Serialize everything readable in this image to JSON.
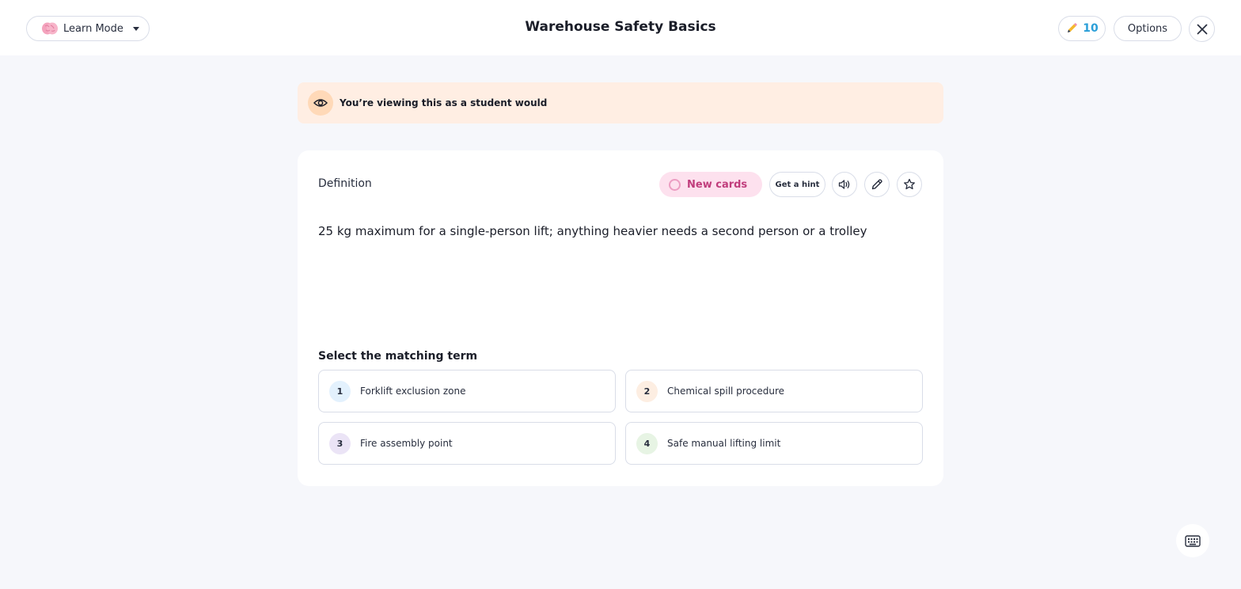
{
  "header": {
    "mode_label": "Learn Mode",
    "title": "Warehouse Safety Basics",
    "streak_count": "10",
    "options_label": "Options"
  },
  "banner": {
    "text": "You’re viewing this as a student would"
  },
  "card": {
    "label": "Definition",
    "status_label": "New cards",
    "hint_label": "Get a hint",
    "definition": "25 kg maximum for a single-person lift; anything heavier needs a second person or a trolley",
    "prompt": "Select the matching term",
    "options": [
      {
        "number": "1",
        "text": "Forklift exclusion zone",
        "color": "#e3f1fd"
      },
      {
        "number": "2",
        "text": "Chemical spill procedure",
        "color": "#fdeee2"
      },
      {
        "number": "3",
        "text": "Fire assembly point",
        "color": "#ebe4f6"
      },
      {
        "number": "4",
        "text": "Safe manual lifting limit",
        "color": "#e7f4e4"
      }
    ]
  },
  "colors": {
    "accent_blue": "#2b9fd8",
    "status_pink": "#c03d7c",
    "banner_bg": "#ffeee3"
  },
  "icons": [
    "brain-icon",
    "caret-down-icon",
    "pencil-icon",
    "close-icon",
    "eye-icon",
    "speaker-icon",
    "edit-icon",
    "star-icon",
    "keyboard-icon"
  ]
}
